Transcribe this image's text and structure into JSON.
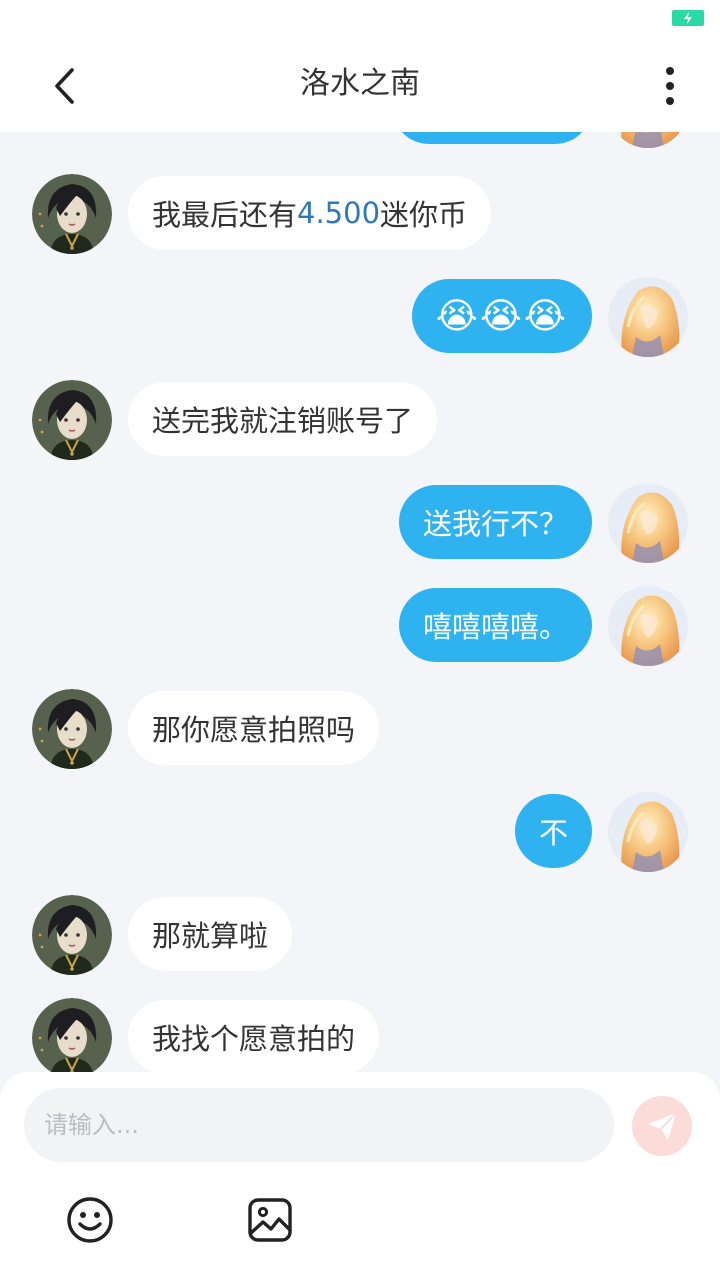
{
  "header": {
    "title": "洛水之南"
  },
  "messages": [
    {
      "side": "left",
      "parts": [
        "我最后还有",
        "4.500",
        "迷你币"
      ]
    },
    {
      "side": "right",
      "emoji": "😭😭😭"
    },
    {
      "side": "left",
      "text": "送完我就注销账号了"
    },
    {
      "side": "right",
      "text": "送我行不？"
    },
    {
      "side": "right",
      "text": "嘻嘻嘻嘻。"
    },
    {
      "side": "left",
      "text": "那你愿意拍照吗"
    },
    {
      "side": "right",
      "text": "不"
    },
    {
      "side": "left",
      "text": "那就算啦"
    },
    {
      "side": "left",
      "text": "我找个愿意拍的"
    }
  ],
  "composer": {
    "placeholder": "请输入..."
  },
  "icons": {
    "back": "chevron-left-icon",
    "more": "more-vertical-icon",
    "send": "paper-plane-icon",
    "emoji": "smiley-icon",
    "image": "image-icon",
    "battery": "battery-charging-icon"
  },
  "colors": {
    "outgoing_bubble": "#2fb3f0",
    "incoming_bubble": "#ffffff",
    "highlight_text": "#2f78b8",
    "send_button": "#fcdcd8",
    "background": "#f3f5f8"
  }
}
